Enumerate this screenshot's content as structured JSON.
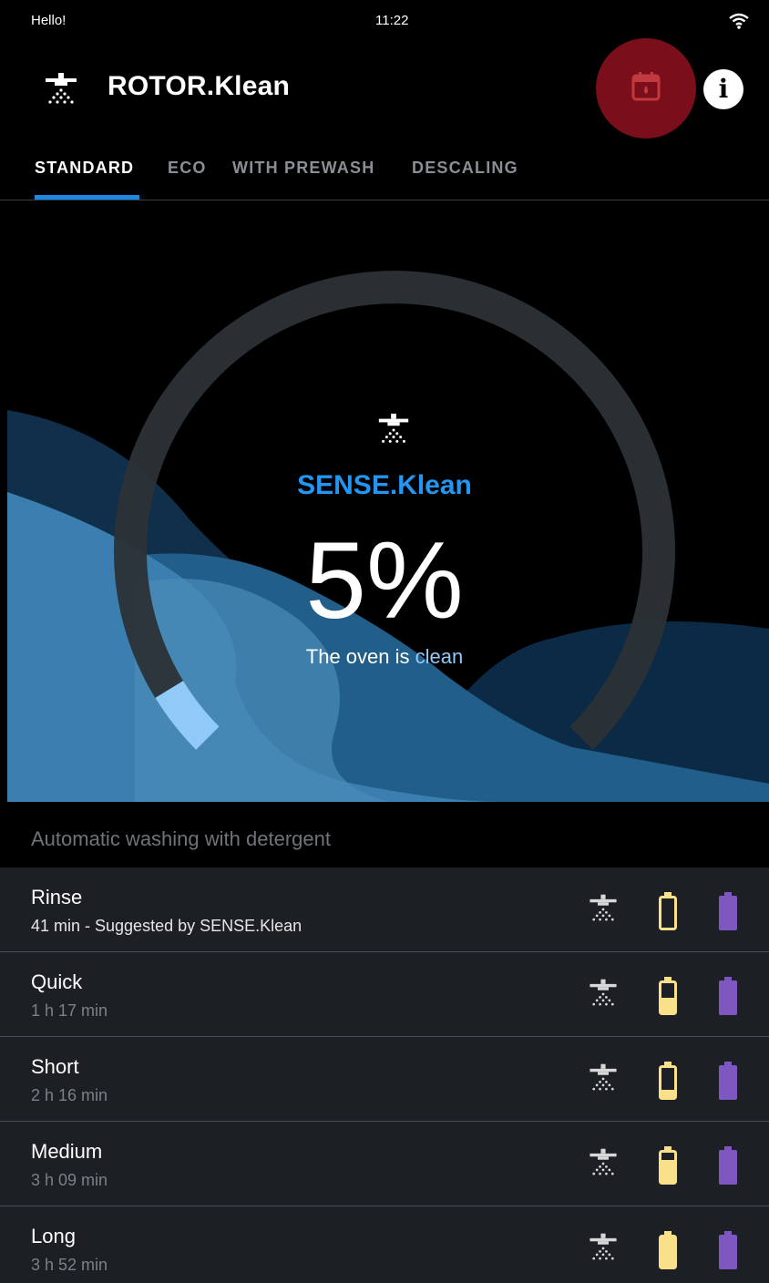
{
  "status_bar": {
    "greeting": "Hello!",
    "time": "11:22",
    "wifi_icon": "wifi-icon"
  },
  "app_bar": {
    "title": "ROTOR.Klean",
    "logo_icon": "shower-icon",
    "calendar_icon": "calendar-drop-icon",
    "info_icon": "info-icon",
    "info_label": "i",
    "calendar_color": "#7a0e1a"
  },
  "tabs": [
    {
      "label": "STANDARD",
      "active": true
    },
    {
      "label": "ECO",
      "active": false
    },
    {
      "label": "WITH PREWASH",
      "active": false
    },
    {
      "label": "DESCALING",
      "active": false
    }
  ],
  "hero": {
    "title": "SENSE.Klean",
    "percent": "5%",
    "gauge_fraction": 0.05,
    "status_prefix": "The oven is",
    "status_value": "clean",
    "accent_color": "#2196f3"
  },
  "section": {
    "title": "Automatic washing with detergent"
  },
  "programs": [
    {
      "name": "Rinse",
      "detail": "41 min - Suggested by SENSE.Klean",
      "suggested": true,
      "detergent_level": 0
    },
    {
      "name": "Quick",
      "detail": "1 h 17 min",
      "suggested": false,
      "detergent_level": 0.5
    },
    {
      "name": "Short",
      "detail": "2 h 16 min",
      "suggested": false,
      "detergent_level": 0.25
    },
    {
      "name": "Medium",
      "detail": "3 h 09 min",
      "suggested": false,
      "detergent_level": 0.75
    },
    {
      "name": "Long",
      "detail": "3 h 52 min",
      "suggested": false,
      "detergent_level": 1
    }
  ],
  "colors": {
    "detergent": "#fbe08a",
    "rinse_aid": "#7e57c2",
    "tab_indicator": "#1e88e5"
  }
}
